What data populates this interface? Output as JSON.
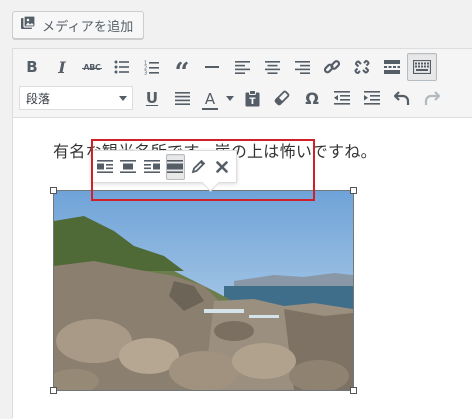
{
  "media": {
    "label": "メディアを追加",
    "icon": "media-add-icon"
  },
  "toolbar_row1": [
    {
      "name": "bold-button",
      "icon": "bold-icon",
      "text": "B"
    },
    {
      "name": "italic-button",
      "icon": "italic-icon",
      "text": "I"
    },
    {
      "name": "strikethrough-button",
      "icon": "strikethrough-icon",
      "text": "ABC"
    },
    {
      "name": "bulleted-list-button",
      "icon": "bulleted-list-icon"
    },
    {
      "name": "numbered-list-button",
      "icon": "numbered-list-icon"
    },
    {
      "name": "blockquote-button",
      "icon": "blockquote-icon",
      "text": "“"
    },
    {
      "name": "horizontal-line-button",
      "icon": "horizontal-line-icon"
    },
    {
      "name": "align-left-button",
      "icon": "align-left-icon"
    },
    {
      "name": "align-center-button",
      "icon": "align-center-icon"
    },
    {
      "name": "align-right-button",
      "icon": "align-right-icon"
    },
    {
      "name": "insert-link-button",
      "icon": "link-icon"
    },
    {
      "name": "remove-link-button",
      "icon": "unlink-icon"
    },
    {
      "name": "read-more-button",
      "icon": "read-more-icon"
    },
    {
      "name": "toolbar-toggle-button",
      "icon": "keyboard-icon"
    }
  ],
  "format_select": {
    "value": "段落"
  },
  "toolbar_row2": [
    {
      "name": "underline-button",
      "icon": "underline-icon",
      "text": "U"
    },
    {
      "name": "justify-button",
      "icon": "justify-icon"
    },
    {
      "name": "text-color-button",
      "icon": "text-color-icon",
      "text": "A"
    },
    {
      "name": "paste-as-text-button",
      "icon": "paste-text-icon"
    },
    {
      "name": "clear-formatting-button",
      "icon": "eraser-icon"
    },
    {
      "name": "special-character-button",
      "icon": "omega-icon",
      "text": "Ω"
    },
    {
      "name": "outdent-button",
      "icon": "outdent-icon"
    },
    {
      "name": "indent-button",
      "icon": "indent-icon"
    },
    {
      "name": "undo-button",
      "icon": "undo-icon"
    },
    {
      "name": "redo-button",
      "icon": "redo-icon"
    }
  ],
  "content": {
    "paragraph": "有名な観光名所です。崖の上は怖いですね。"
  },
  "image_toolbar": [
    {
      "name": "image-align-left-button",
      "icon": "align-left-icon"
    },
    {
      "name": "image-align-center-button",
      "icon": "align-center-icon"
    },
    {
      "name": "image-align-right-button",
      "icon": "align-right-icon"
    },
    {
      "name": "image-align-none-button",
      "icon": "align-none-icon",
      "active": true
    },
    {
      "name": "image-edit-button",
      "icon": "pencil-icon"
    },
    {
      "name": "image-remove-button",
      "icon": "close-icon"
    }
  ],
  "colors": {
    "highlight": "#d0202a",
    "icon": "#555d66",
    "disabled": "#b4b9be"
  }
}
